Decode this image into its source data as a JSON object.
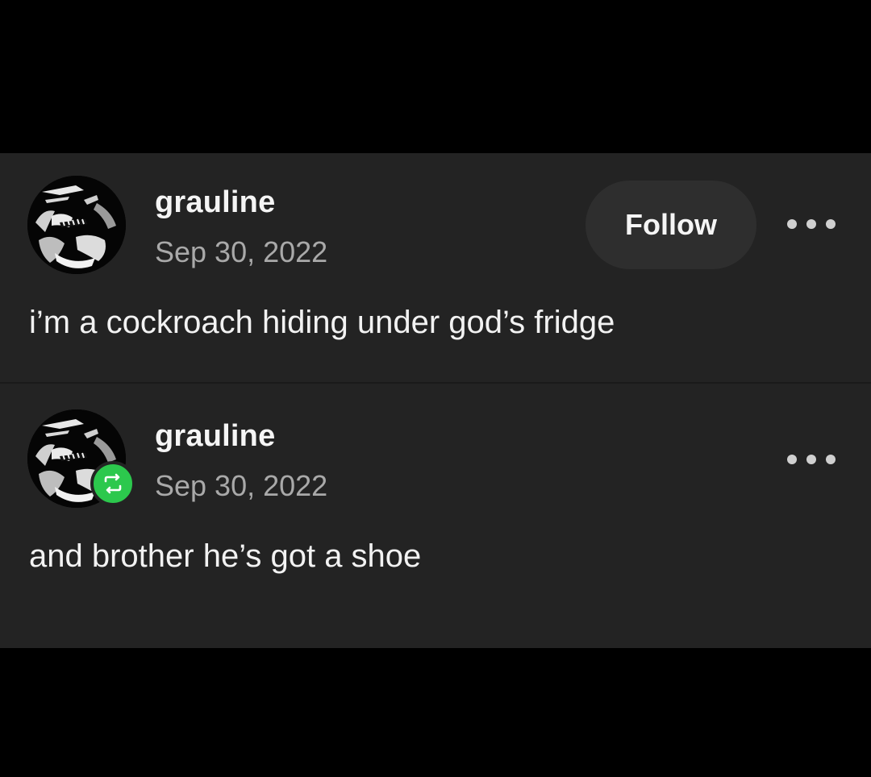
{
  "posts": [
    {
      "username": "grauline",
      "date": "Sep 30, 2022",
      "follow_label": "Follow",
      "text": "i’m a cockroach hiding under god’s fridge",
      "avatar_icon": "avatar-image",
      "more_icon": "more-options-icon"
    },
    {
      "username": "grauline",
      "date": "Sep 30, 2022",
      "text": "and brother he’s got a shoe",
      "avatar_icon": "avatar-image",
      "badge_icon": "reblog-icon",
      "more_icon": "more-options-icon"
    }
  ],
  "colors": {
    "background": "#000000",
    "card": "#232323",
    "follow_button": "#2e2e2e",
    "reblog_badge": "#2cc84d",
    "date_text": "#a9a9a9"
  }
}
